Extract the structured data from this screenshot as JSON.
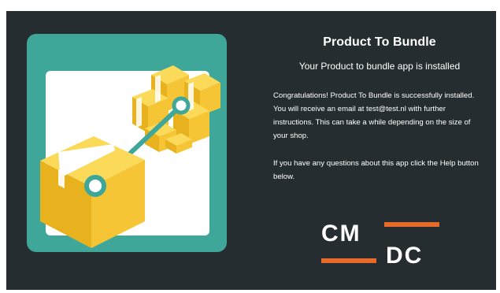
{
  "panel": {
    "title": "Product To Bundle",
    "subtitle": "Your Product to bundle app is installed",
    "paragraph1": "Congratulations! Product To Bundle is successfully installed. You will receive an email at test@test.nl with further instructions. This can take a while depending on the size of your shop.",
    "paragraph2": "If you have any questions about this app click the Help button below."
  },
  "logo": {
    "line1": "CM",
    "line2": "DC",
    "accent_color": "#e86a2b",
    "text_color": "#ffffff"
  },
  "illustration": {
    "name": "product-to-bundle-illustration",
    "teal": "#3ea79a",
    "box_yellow": "#f5c536",
    "box_dark": "#e8b21f"
  },
  "colors": {
    "background": "#262d30",
    "text": "#ffffff"
  }
}
